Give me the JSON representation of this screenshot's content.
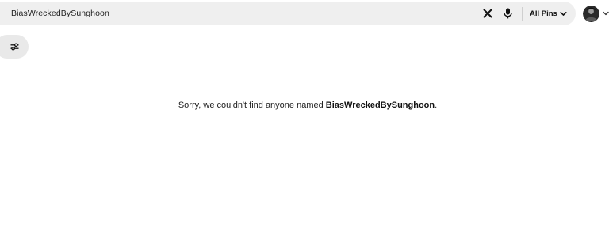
{
  "search": {
    "query": "BiasWreckedBySunghoon"
  },
  "filter": {
    "selected": "All Pins"
  },
  "icons": {
    "clear": "close-icon",
    "mic": "microphone-icon",
    "filter_chevron": "chevron-down-icon",
    "account_chevron": "chevron-down-icon",
    "filters": "sliders-icon"
  },
  "results": {
    "empty_prefix": "Sorry, we couldn't find anyone named ",
    "empty_name": "BiasWreckedBySunghoon",
    "empty_suffix": "."
  },
  "colors": {
    "search_bg": "#efefef",
    "filters_button_bg": "#e9e9e9",
    "page_bg": "#ffffff"
  }
}
